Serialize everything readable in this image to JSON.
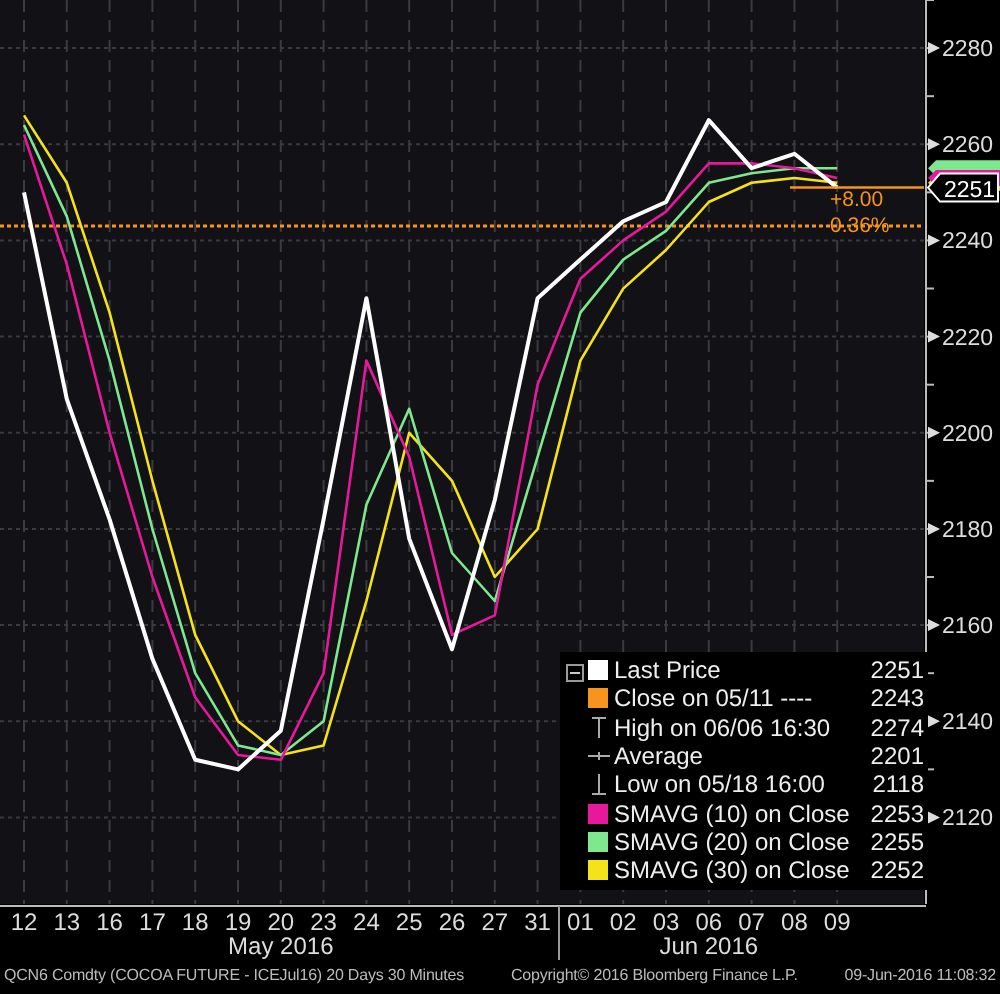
{
  "chart": {
    "chart_data": {
      "type": "line",
      "categories": [
        "12",
        "13",
        "16",
        "17",
        "18",
        "19",
        "20",
        "23",
        "24",
        "25",
        "26",
        "27",
        "31",
        "01",
        "02",
        "03",
        "06",
        "07",
        "08",
        "09"
      ],
      "series": [
        {
          "name": "Last Price",
          "color": "#ffffff",
          "values": [
            2250,
            2207,
            2182,
            2153,
            2132,
            2130,
            2138,
            2182,
            2228,
            2178,
            2155,
            2186,
            2228,
            2236,
            2244,
            2248,
            2265,
            2255,
            2258,
            2251
          ]
        },
        {
          "name": "SMAVG (10) on Close",
          "color": "#e6199a",
          "values": [
            2262,
            2235,
            2200,
            2170,
            2145,
            2133,
            2132,
            2150,
            2215,
            2195,
            2158,
            2162,
            2210,
            2232,
            2240,
            2246,
            2256,
            2256,
            2255,
            2253
          ]
        },
        {
          "name": "SMAVG (20) on Close",
          "color": "#7ee88f",
          "values": [
            2264,
            2245,
            2215,
            2180,
            2150,
            2135,
            2133,
            2140,
            2185,
            2205,
            2175,
            2165,
            2195,
            2225,
            2236,
            2242,
            2252,
            2254,
            2255,
            2255
          ]
        },
        {
          "name": "SMAVG (30) on Close",
          "color": "#f5e31a",
          "values": [
            2266,
            2252,
            2225,
            2190,
            2158,
            2140,
            2133,
            2135,
            2165,
            2200,
            2190,
            2170,
            2180,
            2215,
            2230,
            2238,
            2248,
            2252,
            2253,
            2252
          ]
        }
      ],
      "ylim": [
        2102,
        2290
      ],
      "yticks": [
        2120,
        2140,
        2160,
        2180,
        2200,
        2220,
        2240,
        2260,
        2280
      ],
      "grid": true,
      "ref_lines": [
        {
          "axis": "y",
          "value": 2243,
          "color": "#f7941d"
        }
      ]
    },
    "months": [
      "May 2016",
      "Jun 2016"
    ],
    "last_tag": "2251",
    "change": "+8.00",
    "change_pct": "0.36%",
    "legend": [
      {
        "kind": "series",
        "value": "2251"
      },
      {
        "kind": "swatch",
        "label": "Close on 05/11 ----",
        "value": "2243",
        "color": "#f7941d"
      },
      {
        "kind": "high",
        "label": "High on 06/06 16:30",
        "value": "2274"
      },
      {
        "kind": "average",
        "label": "Average",
        "value": "2201"
      },
      {
        "kind": "low",
        "label": "Low on 05/18 16:00",
        "value": "2118"
      },
      {
        "kind": "series",
        "value": "2253"
      },
      {
        "kind": "series",
        "value": "2255"
      },
      {
        "kind": "series",
        "value": "2252"
      }
    ]
  },
  "footer": {
    "description": "QCN6 Comdty (COCOA FUTURE - ICEJul16) 20 Days 30 Minutes",
    "copyright": "Copyright© 2016 Bloomberg Finance L.P.",
    "timestamp": "09-Jun-2016 11:08:32"
  }
}
